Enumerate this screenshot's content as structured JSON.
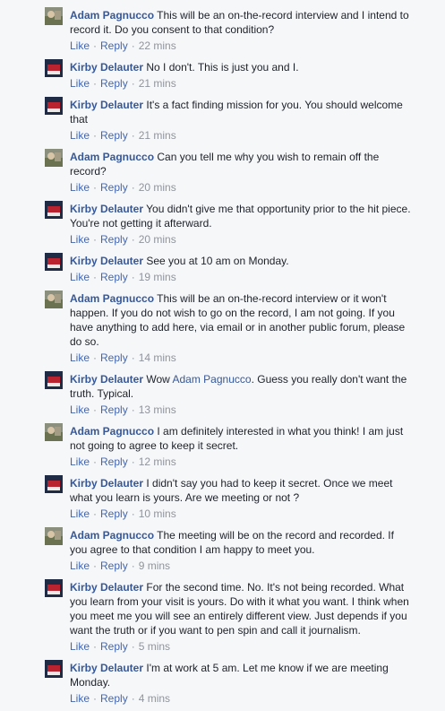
{
  "comments": [
    {
      "author": "Adam Pagnucco",
      "text": "This will be an on-the-record interview and I intend to record it. Do you consent to that condition?",
      "like": "Like",
      "reply": "Reply",
      "time": "22 mins"
    },
    {
      "author": "Kirby Delauter",
      "text": "No I don't. This is just you and I.",
      "like": "Like",
      "reply": "Reply",
      "time": "21 mins"
    },
    {
      "author": "Kirby Delauter",
      "text": "It's a fact finding mission for you. You should welcome that",
      "like": "Like",
      "reply": "Reply",
      "time": "21 mins"
    },
    {
      "author": "Adam Pagnucco",
      "text": "Can you tell me why you wish to remain off the record?",
      "like": "Like",
      "reply": "Reply",
      "time": "20 mins"
    },
    {
      "author": "Kirby Delauter",
      "text": "You didn't give me that opportunity prior to the hit piece. You're not getting it afterward.",
      "like": "Like",
      "reply": "Reply",
      "time": "20 mins"
    },
    {
      "author": "Kirby Delauter",
      "text": "See you at 10 am on Monday.",
      "like": "Like",
      "reply": "Reply",
      "time": "19 mins"
    },
    {
      "author": "Adam Pagnucco",
      "text": "This will be an on-the-record interview or it won't happen. If you do not wish to go on the record, I am not going. If you have anything to add here, via email or in another public forum, please do so.",
      "like": "Like",
      "reply": "Reply",
      "time": "14 mins"
    },
    {
      "author": "Kirby Delauter",
      "text_before": "Wow",
      "mention": "Adam Pagnucco",
      "text_after": ". Guess you really don't want the truth. Typical.",
      "like": "Like",
      "reply": "Reply",
      "time": "13 mins"
    },
    {
      "author": "Adam Pagnucco",
      "text": "I am definitely interested in what you think! I am just not going to agree to keep it secret.",
      "like": "Like",
      "reply": "Reply",
      "time": "12 mins"
    },
    {
      "author": "Kirby Delauter",
      "text": "I didn't say you had to keep it secret. Once we meet what you learn is yours. Are we meeting or not ?",
      "like": "Like",
      "reply": "Reply",
      "time": "10 mins"
    },
    {
      "author": "Adam Pagnucco",
      "text": "The meeting will be on the record and recorded. If you agree to that condition I am happy to meet you.",
      "like": "Like",
      "reply": "Reply",
      "time": "9 mins"
    },
    {
      "author": "Kirby Delauter",
      "text": "For the second time. No. It's not being recorded. What you learn from your visit is yours. Do with it what you want. I think when you meet me you will see an entirely different view. Just depends if you want the truth or if you want to pen spin and call it journalism.",
      "like": "Like",
      "reply": "Reply",
      "time": "5 mins"
    },
    {
      "author": "Kirby Delauter",
      "text": "I'm at work at 5 am. Let me know if we are meeting Monday.",
      "like": "Like",
      "reply": "Reply",
      "time": "4 mins"
    }
  ]
}
